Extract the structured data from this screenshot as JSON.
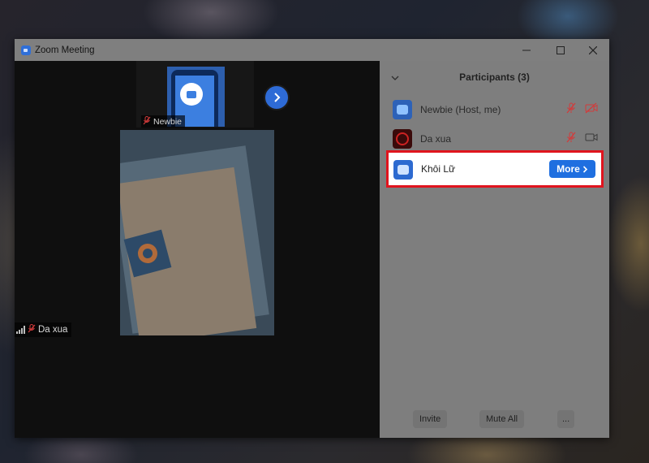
{
  "window": {
    "title": "Zoom Meeting",
    "controls": {
      "minimize": "minimize",
      "maximize": "maximize",
      "close": "close"
    }
  },
  "video": {
    "strip_tile": {
      "name": "Newbie",
      "mic": "muted"
    },
    "next_page_icon": "chevron-right-icon",
    "main_tile": {
      "name": "Da xua",
      "mic": "muted",
      "signal": "connection-signal"
    }
  },
  "participants": {
    "title": "Participants (3)",
    "items": [
      {
        "name": "Newbie (Host, me)",
        "mic": "muted",
        "video": "off"
      },
      {
        "name": "Da xua",
        "mic": "muted",
        "video": "on"
      },
      {
        "name": "Khôi Lữ",
        "action": "More"
      }
    ],
    "footer": {
      "invite": "Invite",
      "mute_all": "Mute All",
      "more": "..."
    }
  },
  "colors": {
    "accent": "#1f6fe0",
    "highlight_border": "#e0141e",
    "muted": "#d23b3b"
  }
}
